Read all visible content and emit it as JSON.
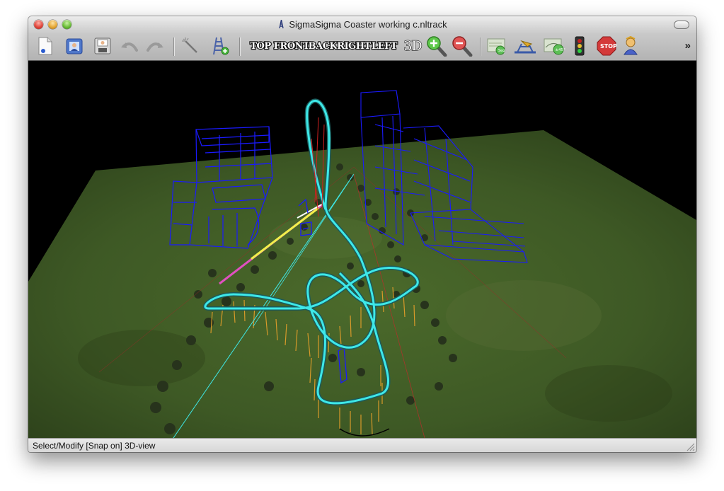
{
  "window": {
    "title": "SigmaSigma Coaster working c.nltrack"
  },
  "toolbar": {
    "new_icon": "new-document-icon",
    "open_icon": "open-icon",
    "save_icon": "save-icon",
    "undo_icon": "undo-icon",
    "redo_icon": "redo-icon",
    "select_icon": "magic-wand-icon",
    "add_support_icon": "add-support-icon",
    "view_top": "TOP",
    "view_front": "FRONT",
    "view_back": "BACK",
    "view_right": "RIGHT",
    "view_left": "LEFT",
    "view_3d": "3D",
    "zoom_in_icon": "zoom-in-icon",
    "zoom_out_icon": "zoom-out-icon",
    "more_label": "»"
  },
  "status": {
    "text": "Select/Modify [Snap on] 3D-view"
  },
  "colors": {
    "track": "#3ee8e8",
    "structures": "#1a1aff",
    "supports": "#e0a020",
    "ground": "#3f5a26"
  }
}
